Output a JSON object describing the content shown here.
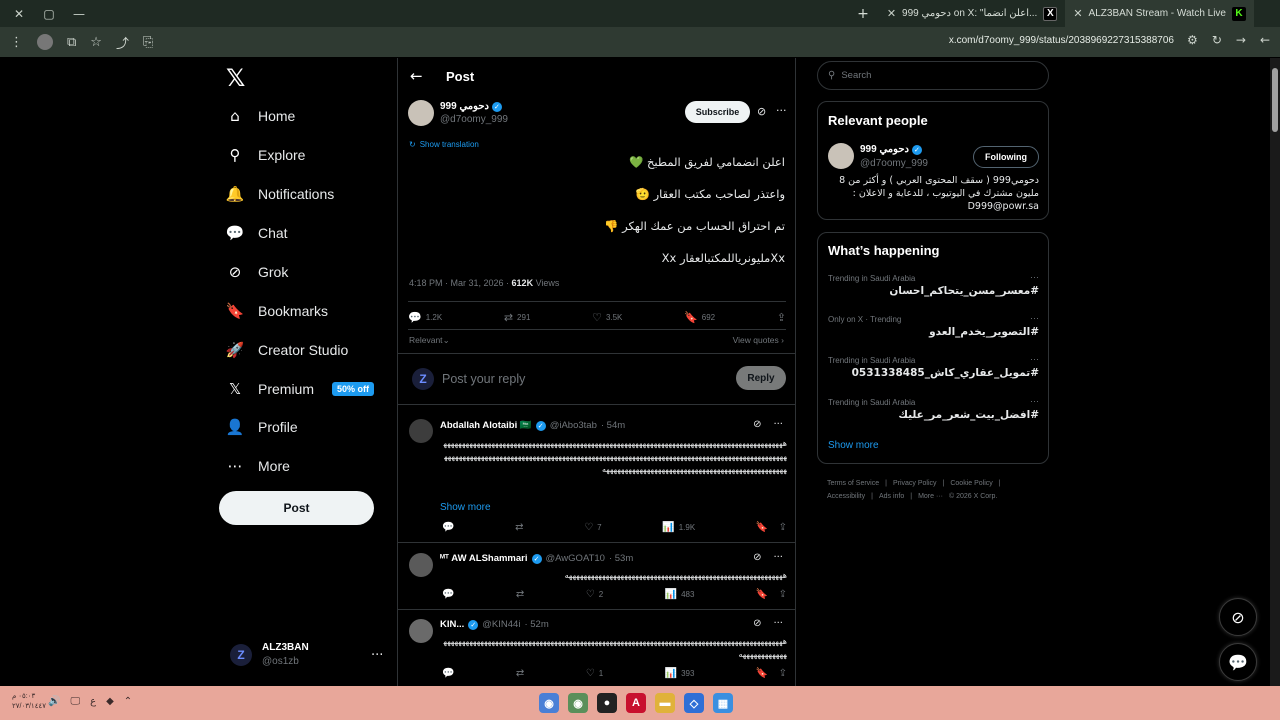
{
  "browser": {
    "window_controls": [
      "✕",
      "▢",
      "—"
    ],
    "tabs": [
      {
        "title": "ALZ3BAN Stream - Watch Live",
        "icon": "K",
        "icon_color": "#53fc18"
      },
      {
        "title": "دحومي 999 on X: \"اعلن انضما...",
        "icon": "X",
        "icon_color": "#000000"
      }
    ],
    "new_tab": "+",
    "url": "x.com/d7oomy_999/status/2038969227315388706"
  },
  "nav": {
    "logo": "𝕏",
    "items": [
      {
        "label": "Home",
        "icon": "⌂"
      },
      {
        "label": "Explore",
        "icon": "⚲"
      },
      {
        "label": "Notifications",
        "icon": "🔔"
      },
      {
        "label": "Chat",
        "icon": "💬"
      },
      {
        "label": "Grok",
        "icon": "⊘"
      },
      {
        "label": "Bookmarks",
        "icon": "🔖"
      },
      {
        "label": "Creator Studio",
        "icon": "🚀"
      },
      {
        "label": "Premium",
        "icon": "𝕏"
      },
      {
        "label": "Profile",
        "icon": "👤"
      },
      {
        "label": "More",
        "icon": "⋯"
      }
    ],
    "premium_badge": "50% off",
    "post_button": "Post",
    "account": {
      "name": "ALZ3BAN",
      "handle": "@os1zb",
      "initial": "Z"
    }
  },
  "post": {
    "header_title": "Post",
    "author_name": "دحومي 999",
    "author_handle": "@d7oomy_999",
    "subscribe_label": "Subscribe",
    "show_translation": "Show translation",
    "lines": [
      "اعلن انضمامي لفريق المطبخ 💚",
      "واعتذر لصاحب مكتب العقار 🫡",
      "تم احتراق الحساب من عمك الهكر 👎",
      "Xxمليونرياللمكتبالعقار Xx"
    ],
    "time": "4:18 PM · Mar 31, 2026 · ",
    "views_count": "612K",
    "views_label": " Views",
    "stats": {
      "replies": "1.2K",
      "reposts": "291",
      "likes": "3.5K",
      "bookmarks": "692"
    },
    "relevant_label": "Relevant",
    "view_quotes": "View quotes"
  },
  "reply_box": {
    "placeholder": "Post your reply",
    "button": "Reply"
  },
  "replies": [
    {
      "name": "Abdallah Alotaibi 🇸🇦",
      "handle": "@iAbo3tab",
      "age": "· 54m",
      "body": "هههههههههههههههههههههههههههههههههههههههههههههههههههههههههههههههههههههههههههههههههههههههههههههههههههههههههههههههههههههههههههههههههههههههههههههههههههههههههههههههههههههههههههههههههههههههههههههههههههههههههههههههههههههههههههههههههههههههههههه",
      "show_more": "Show more",
      "likes": "7",
      "views": "1.9K"
    },
    {
      "name": "ᴹᵀ AW ALShammari",
      "handle": "@AwGOAT10",
      "age": "· 53m",
      "body": "هههههههههههههههههههههههههههههههههههههههههههههههههههههههههههه",
      "likes": "2",
      "views": "483"
    },
    {
      "name": "KIN...",
      "handle": "@KIN44i",
      "age": "· 52m",
      "body": "هههههههههههههههههههههههههههههههههههههههههههههههههههههههههههههههههههههههههههههههههههههههههههههههههههههههههه",
      "likes": "1",
      "views": "393"
    }
  ],
  "right": {
    "search_placeholder": "Search",
    "relevant_people_title": "Relevant people",
    "person": {
      "name": "دحومي 999",
      "handle": "@d7oomy_999",
      "following_label": "Following",
      "bio": "دحومي999 ( سقف المحتوى العربي ) و أكثر من 8 مليون مشترك في اليوتيوب ، للدعاية و الاعلان : D999@powr.sa"
    },
    "happening_title": "What’s happening",
    "trends": [
      {
        "context": "Trending in Saudi Arabia",
        "tag": "#معسر_مسن_يتحاكم_احسان"
      },
      {
        "context": "Only on X · Trending",
        "tag": "#التصوير_يخدم_العدو"
      },
      {
        "context": "Trending in Saudi Arabia",
        "tag": "#تمويل_عقاري_كاش_0531338485"
      },
      {
        "context": "Trending in Saudi Arabia",
        "tag": "#افضل_بيت_شعر_مر_عليك"
      }
    ],
    "show_more": "Show more",
    "footer_links": [
      "Terms of Service",
      "|",
      "Privacy Policy",
      "|",
      "Cookie Policy",
      "|",
      "Accessibility",
      "|",
      "Ads info",
      "|",
      "More ···",
      "© 2026 X Corp."
    ]
  },
  "taskbar": {
    "time": "٠٥:٠٣ م",
    "date": "٢٧/٠٣/١٤٤٧",
    "lang": "ع"
  }
}
